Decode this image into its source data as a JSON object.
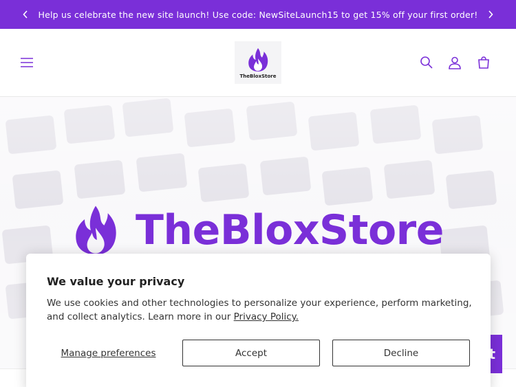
{
  "announcement": {
    "text": "Help us celebrate the new site launch! Use code: NewSiteLaunch15 to get 15% off your first order!"
  },
  "header": {
    "logo_text": "TheBloxStore"
  },
  "hero": {
    "brand_title": "TheBloxStore"
  },
  "cookie_banner": {
    "title": "We value your privacy",
    "body": "We use cookies and other technologies to personalize your experience, perform marketing, and collect analytics. Learn more in our ",
    "policy_link": "Privacy Policy.",
    "manage_label": "Manage preferences",
    "accept_label": "Accept",
    "decline_label": "Decline"
  },
  "chat": {
    "label": "t"
  },
  "colors": {
    "brand_purple": "#7a2fd8",
    "text_dark": "#121212",
    "banner_border": "#333333"
  },
  "icons": [
    "chevron-left-icon",
    "chevron-right-icon",
    "menu-icon",
    "flame-icon",
    "search-icon",
    "account-icon",
    "cart-icon"
  ]
}
